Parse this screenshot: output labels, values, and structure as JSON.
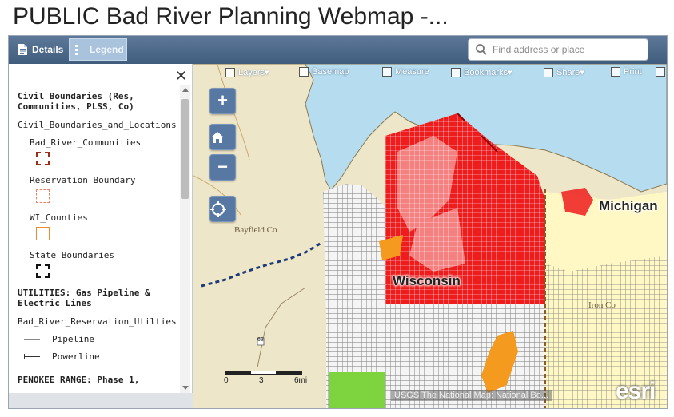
{
  "page": {
    "title": "PUBLIC Bad River Planning Webmap -..."
  },
  "toolbar": {
    "details_label": "Details",
    "legend_label": "Legend",
    "search_placeholder": "Find address or place"
  },
  "legend": {
    "sections": [
      {
        "heading": "Civil Boundaries (Res, Communities, PLSS, Co)",
        "layer": "Civil_Boundaries_and_Locations",
        "items": [
          "Bad_River_Communities",
          "Reservation_Boundary",
          "WI_Counties",
          "State_Boundaries"
        ]
      },
      {
        "heading": "UTILITIES: Gas Pipeline & Electric Lines",
        "layer": "Bad_River_Reservation_Utilties",
        "items": [
          "Pipeline",
          "Powerline"
        ]
      },
      {
        "heading": "PENOKEE RANGE: Phase 1,"
      }
    ]
  },
  "map_tools": {
    "layers": "Layers",
    "basemap": "Basemap",
    "measure": "Measure",
    "bookmarks": "Bookmarks",
    "share": "Share",
    "print": "Print"
  },
  "map": {
    "labels": {
      "wisconsin": "Wisconsin",
      "michigan": "Michigan",
      "bayfield": "Bayfield Co",
      "iron": "Iron Co",
      "highway": "63"
    },
    "attribution": "USGS The National Map: National Bo...",
    "esri": "esri",
    "scale": {
      "t0": "0",
      "t1": "3",
      "t2": "6mi"
    },
    "colors": {
      "lake": "#b6dcef",
      "land": "#eee6c8",
      "reservation": "#ee1c1c",
      "reservation_light": "#f58080",
      "michigan_fill": "#fff8c4",
      "orange": "#f39a1f",
      "green": "#7ed43e"
    }
  }
}
